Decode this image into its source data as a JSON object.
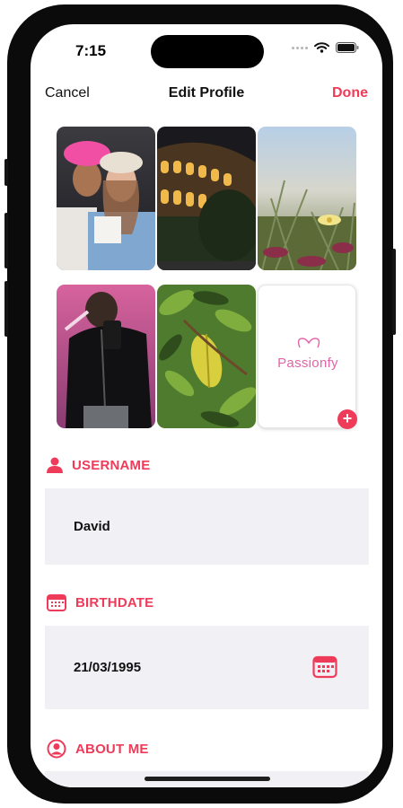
{
  "status": {
    "time": "7:15"
  },
  "nav": {
    "cancel_label": "Cancel",
    "title": "Edit Profile",
    "done_label": "Done"
  },
  "photos": [
    {
      "name": "couple-photo",
      "description_icon": "photo"
    },
    {
      "name": "colosseum-photo",
      "description_icon": "photo"
    },
    {
      "name": "flower-photo",
      "description_icon": "photo"
    },
    {
      "name": "jacket-photo",
      "description_icon": "photo"
    },
    {
      "name": "leaves-photo",
      "description_icon": "photo"
    }
  ],
  "add_photo": {
    "logo_text": "Passionfy",
    "add_icon": "plus-icon"
  },
  "username": {
    "label": "USERNAME",
    "value": "David",
    "icon": "person-icon"
  },
  "birthdate": {
    "label": "BIRTHDATE",
    "value": "21/03/1995",
    "icon": "calendar-icon"
  },
  "about": {
    "label": "ABOUT ME",
    "icon": "person-circle-icon"
  },
  "colors": {
    "accent": "#ef3b5a",
    "field_bg": "#f0f0f5",
    "logo": "#e264a8"
  }
}
